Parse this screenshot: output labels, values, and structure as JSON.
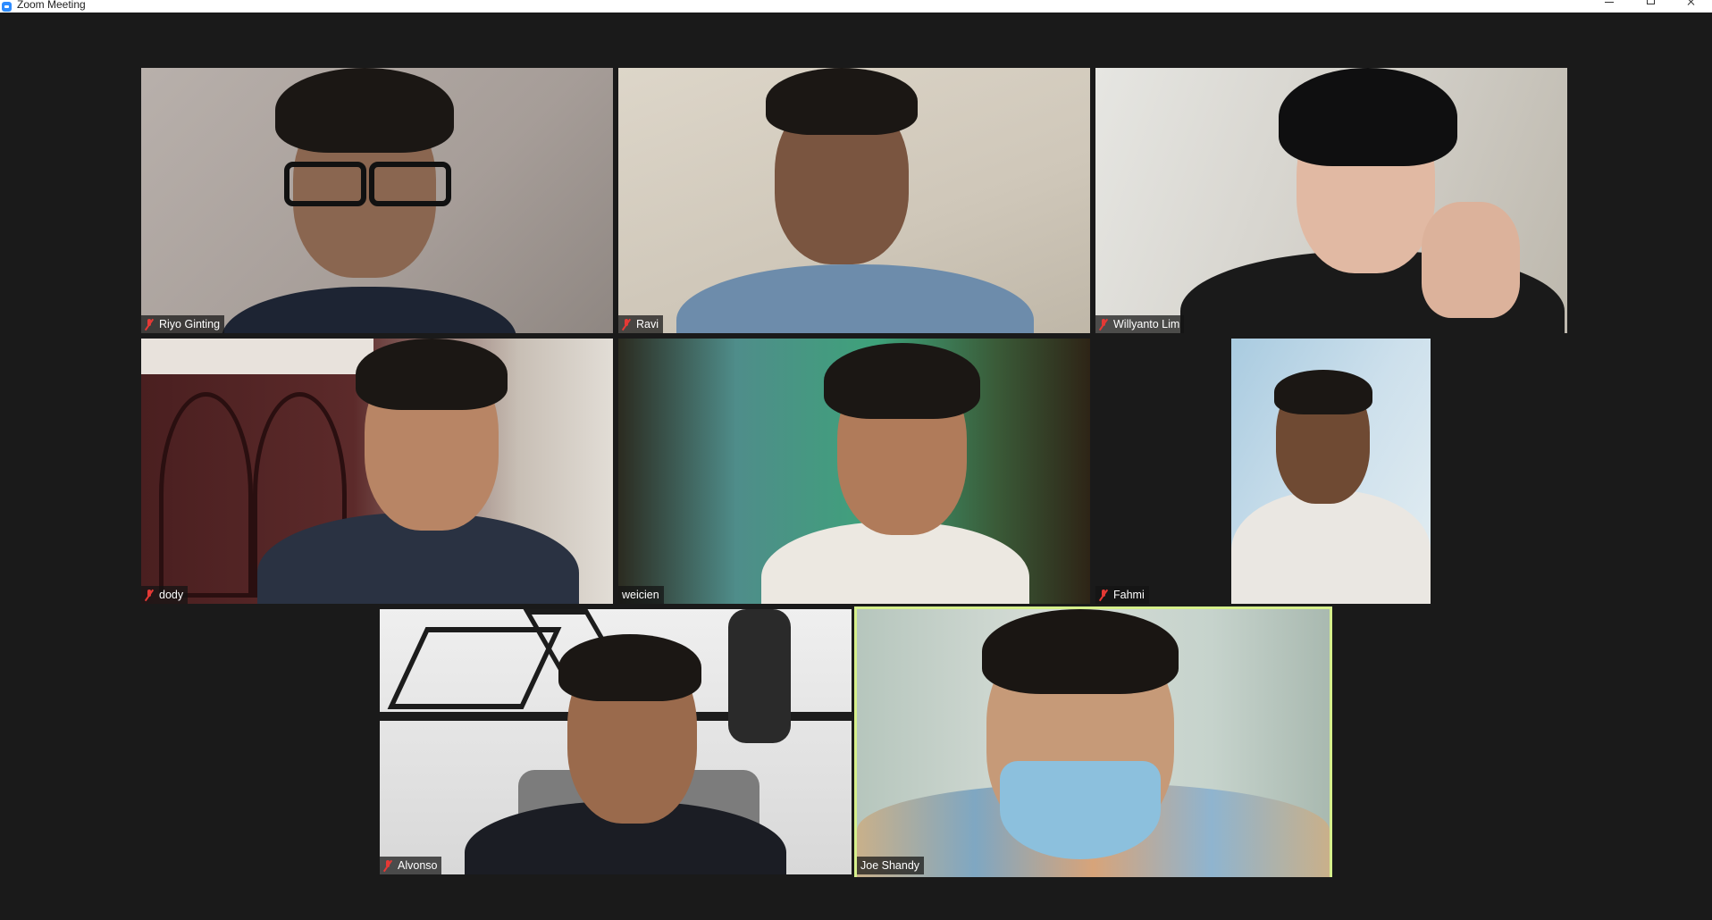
{
  "window": {
    "title": "Zoom Meeting",
    "icon": "zoom-app-icon",
    "controls": [
      "minimize-icon",
      "maximize-icon",
      "close-icon"
    ]
  },
  "accent_colors": {
    "active_speaker_border": "#d6f08c",
    "muted_mic": "#e53935",
    "background": "#1a1a1a"
  },
  "participants": [
    {
      "name": "Riyo Ginting",
      "muted": true
    },
    {
      "name": "Ravi",
      "muted": true
    },
    {
      "name": "Willyanto Lim",
      "muted": true
    },
    {
      "name": "dody",
      "muted": true
    },
    {
      "name": "weicien",
      "muted": false
    },
    {
      "name": "Fahmi",
      "muted": true
    },
    {
      "name": "Alvonso",
      "muted": true
    },
    {
      "name": "Joe Shandy",
      "muted": false,
      "active_speaker": true
    }
  ]
}
